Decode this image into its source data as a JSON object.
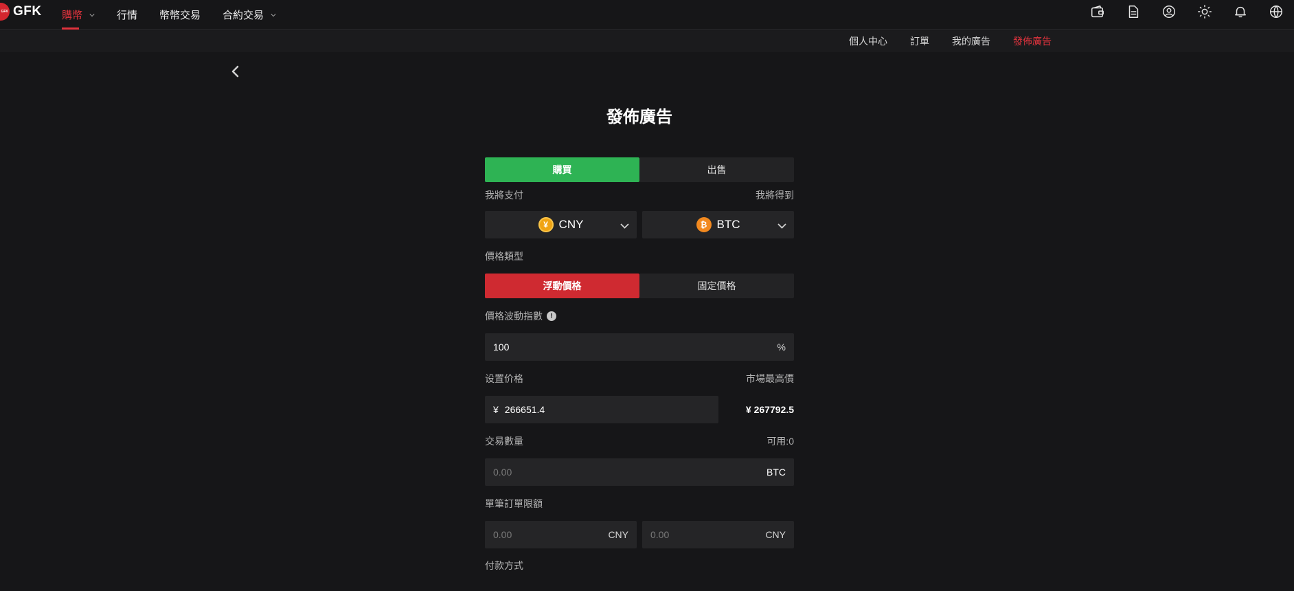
{
  "brand": {
    "name": "GFK",
    "mark_text": "GFK"
  },
  "nav": {
    "items": [
      {
        "label": "購幣",
        "has_caret": true
      },
      {
        "label": "行情",
        "has_caret": false
      },
      {
        "label": "幣幣交易",
        "has_caret": false
      },
      {
        "label": "合約交易",
        "has_caret": true
      }
    ],
    "active": "購幣",
    "accent_color": "#e0333d"
  },
  "top_icons": [
    "wallet-icon",
    "document-icon",
    "user-icon",
    "sun-icon",
    "bell-icon",
    "globe-icon"
  ],
  "subnav": {
    "items": [
      "個人中心",
      "訂單",
      "我的廣告",
      "發佈廣告"
    ],
    "active": "發佈廣告"
  },
  "page_title": "發佈廣告",
  "trade_side": {
    "buy_label": "購買",
    "sell_label": "出售",
    "selected": "購買",
    "buy_color": "#2eb354"
  },
  "currency": {
    "pay_label": "我將支付",
    "get_label": "我將得到",
    "pay_currency": "CNY",
    "pay_symbol": "¥",
    "get_currency": "BTC",
    "get_symbol": "₿"
  },
  "price_type": {
    "label": "價格類型",
    "float_label": "浮動價格",
    "fixed_label": "固定價格",
    "selected": "浮動價格"
  },
  "volatility": {
    "label": "價格波動指數",
    "value": "100",
    "suffix": "%",
    "info_glyph": "!"
  },
  "set_price": {
    "label": "设置价格",
    "market_label": "市場最高價",
    "currency_symbol": "¥",
    "value": "266651.4",
    "market_value": "¥ 267792.5"
  },
  "amount": {
    "label": "交易數量",
    "available": "可用:0",
    "placeholder": "0.00",
    "suffix": "BTC"
  },
  "limit": {
    "label": "單筆訂單限額",
    "min_placeholder": "0.00",
    "max_placeholder": "0.00",
    "suffix": "CNY"
  },
  "payment": {
    "label": "付款方式"
  }
}
